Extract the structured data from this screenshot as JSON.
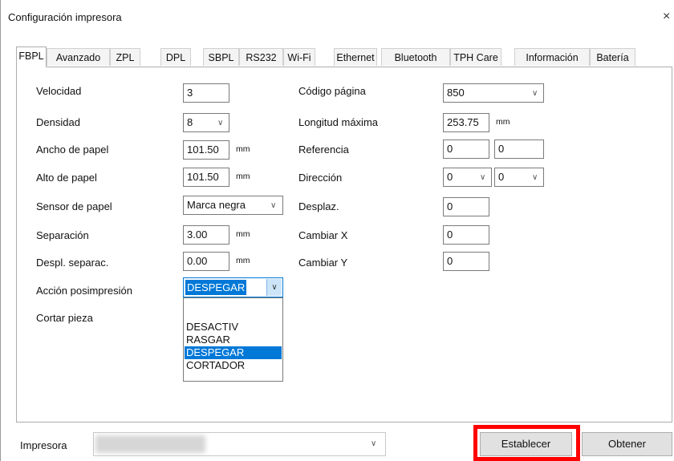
{
  "window": {
    "title": "Configuración impresora",
    "close_glyph": "×"
  },
  "tabs": [
    "FBPL",
    "Avanzado",
    "ZPL",
    "DPL",
    "SBPL",
    "RS232",
    "Wi-Fi",
    "Ethernet",
    "Bluetooth",
    "TPH Care",
    "Información",
    "Batería"
  ],
  "active_tab": "FBPL",
  "left": {
    "velocidad": {
      "label": "Velocidad",
      "value": "3"
    },
    "densidad": {
      "label": "Densidad",
      "value": "8"
    },
    "ancho": {
      "label": "Ancho de papel",
      "value": "101.50",
      "unit": "mm"
    },
    "alto": {
      "label": "Alto de papel",
      "value": "101.50",
      "unit": "mm"
    },
    "sensor": {
      "label": "Sensor de papel",
      "value": "Marca negra"
    },
    "separacion": {
      "label": "Separación",
      "value": "3.00",
      "unit": "mm"
    },
    "despl_separac": {
      "label": "Despl. separac.",
      "value": "0.00",
      "unit": "mm"
    },
    "accion": {
      "label": "Acción posimpresión",
      "value": "DESPEGAR"
    },
    "cortar": {
      "label": "Cortar pieza"
    }
  },
  "dropdown_options": [
    "DESACTIV",
    "RASGAR",
    "DESPEGAR",
    "CORTADOR"
  ],
  "dropdown_selected": "DESPEGAR",
  "right": {
    "codigo": {
      "label": "Código página",
      "value": "850"
    },
    "longitud": {
      "label": "Longitud máxima",
      "value": "253.75",
      "unit": "mm"
    },
    "referencia": {
      "label": "Referencia",
      "value1": "0",
      "value2": "0"
    },
    "direccion": {
      "label": "Dirección",
      "value1": "0",
      "value2": "0"
    },
    "desplaz": {
      "label": "Desplaz.",
      "value": "0"
    },
    "cambiar_x": {
      "label": "Cambiar X",
      "value": "0"
    },
    "cambiar_y": {
      "label": "Cambiar Y",
      "value": "0"
    }
  },
  "footer": {
    "printer_label": "Impresora",
    "set_button": "Establecer",
    "get_button": "Obtener"
  },
  "colors": {
    "highlight": "#ff0000",
    "selection": "#0078d7"
  }
}
